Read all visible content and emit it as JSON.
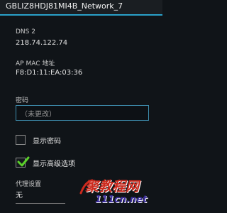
{
  "header": {
    "network_name": "GBLIZ8HDJ81MI4B_Network_7"
  },
  "dns2": {
    "label": "DNS 2",
    "value": "218.74.122.74"
  },
  "ap_mac": {
    "label": "AP MAC 地址",
    "value": "F8:D1:11:EA:03:36"
  },
  "password": {
    "label": "密码",
    "placeholder": "（未更改）",
    "value": ""
  },
  "show_password": {
    "label": "显示密码",
    "checked": false
  },
  "advanced": {
    "label": "显示高级选项",
    "checked": true
  },
  "proxy": {
    "label": "代理设置",
    "value": "无"
  },
  "watermark": {
    "text": "聚教程网",
    "url": "111cn.net"
  },
  "colors": {
    "accent": "#2aa0c8",
    "check": "#5bd02a",
    "watermark_red": "#cc2a1e",
    "watermark_blue": "#3d2fa0"
  }
}
